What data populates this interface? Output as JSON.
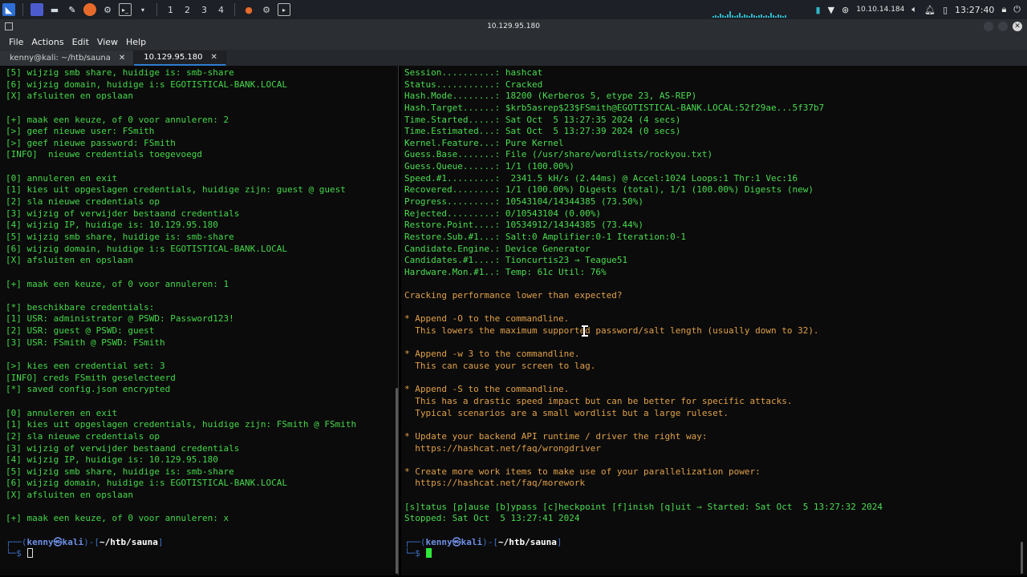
{
  "panel": {
    "workspaces": [
      "1",
      "2",
      "3",
      "4"
    ],
    "ip_label": "10.10.14.184",
    "clock": "13:27:40",
    "accent": "#2fb6c8",
    "icons": [
      "kali-menu-icon",
      "desktop-icon",
      "files-icon",
      "text-editor-icon",
      "firefox-icon",
      "settings-icon",
      "terminal-icon"
    ]
  },
  "window": {
    "title": "10.129.95.180"
  },
  "menu": [
    "File",
    "Actions",
    "Edit",
    "View",
    "Help"
  ],
  "tabs": [
    {
      "label": "kenny@kali: ~/htb/sauna",
      "active": false
    },
    {
      "label": "10.129.95.180",
      "active": true
    }
  ],
  "left_terminal": [
    "[5] wijzig smb share, huidige is: smb-share",
    "[6] wijzig domain, huidige i:s EGOTISTICAL-BANK.LOCAL",
    "[X] afsluiten en opslaan",
    "",
    "[+] maak een keuze, of 0 voor annuleren: 2",
    "[>] geef nieuwe user: FSmith",
    "[>] geef nieuwe password: FSmith",
    "[INFO]  nieuwe credentials toegevoegd",
    "",
    "[0] annuleren en exit",
    "[1] kies uit opgeslagen credentials, huidige zijn: guest @ guest",
    "[2] sla nieuwe credentials op",
    "[3] wijzig of verwijder bestaand credentials",
    "[4] wijzig IP, huidige is: 10.129.95.180",
    "[5] wijzig smb share, huidige is: smb-share",
    "[6] wijzig domain, huidige i:s EGOTISTICAL-BANK.LOCAL",
    "[X] afsluiten en opslaan",
    "",
    "[+] maak een keuze, of 0 voor annuleren: 1",
    "",
    "[*] beschikbare credentials:",
    "[1] USR: administrator @ PSWD: Password123!",
    "[2] USR: guest @ PSWD: guest",
    "[3] USR: FSmith @ PSWD: FSmith",
    "",
    "[>] kies een credential set: 3",
    "[INFO] creds FSmith geselecteerd",
    "[*] saved config.json encrypted",
    "",
    "[0] annuleren en exit",
    "[1] kies uit opgeslagen credentials, huidige zijn: FSmith @ FSmith",
    "[2] sla nieuwe credentials op",
    "[3] wijzig of verwijder bestaand credentials",
    "[4] wijzig IP, huidige is: 10.129.95.180",
    "[5] wijzig smb share, huidige is: smb-share",
    "[6] wijzig domain, huidige i:s EGOTISTICAL-BANK.LOCAL",
    "[X] afsluiten en opslaan",
    "",
    "[+] maak een keuze, of 0 voor annuleren: x",
    ""
  ],
  "right_terminal": [
    "Session..........: hashcat",
    "Status...........: Cracked",
    "Hash.Mode........: 18200 (Kerberos 5, etype 23, AS-REP)",
    "Hash.Target......: $krb5asrep$23$FSmith@EGOTISTICAL-BANK.LOCAL:52f29ae...5f37b7",
    "Time.Started.....: Sat Oct  5 13:27:35 2024 (4 secs)",
    "Time.Estimated...: Sat Oct  5 13:27:39 2024 (0 secs)",
    "Kernel.Feature...: Pure Kernel",
    "Guess.Base.......: File (/usr/share/wordlists/rockyou.txt)",
    "Guess.Queue......: 1/1 (100.00%)",
    "Speed.#1.........:  2341.5 kH/s (2.44ms) @ Accel:1024 Loops:1 Thr:1 Vec:16",
    "Recovered........: 1/1 (100.00%) Digests (total), 1/1 (100.00%) Digests (new)",
    "Progress.........: 10543104/14344385 (73.50%)",
    "Rejected.........: 0/10543104 (0.00%)",
    "Restore.Point....: 10534912/14344385 (73.44%)",
    "Restore.Sub.#1...: Salt:0 Amplifier:0-1 Iteration:0-1",
    "Candidate.Engine.: Device Generator",
    "Candidates.#1....: Tioncurtis23 → Teague51",
    "Hardware.Mon.#1..: Temp: 61c Util: 76%",
    ""
  ],
  "right_warnings": [
    "Cracking performance lower than expected?",
    "",
    "* Append -O to the commandline.",
    "  This lowers the maximum supported password/salt length (usually down to 32).",
    "",
    "* Append -w 3 to the commandline.",
    "  This can cause your screen to lag.",
    "",
    "* Append -S to the commandline.",
    "  This has a drastic speed impact but can be better for specific attacks.",
    "  Typical scenarios are a small wordlist but a large ruleset.",
    "",
    "* Update your backend API runtime / driver the right way:",
    "  https://hashcat.net/faq/wrongdriver",
    "",
    "* Create more work items to make use of your parallelization power:",
    "  https://hashcat.net/faq/morework",
    ""
  ],
  "right_tail": [
    "[s]tatus [p]ause [b]ypass [c]heckpoint [f]inish [q]uit ⇒ Started: Sat Oct  5 13:27:32 2024",
    "Stopped: Sat Oct  5 13:27:41 2024",
    ""
  ],
  "prompt": {
    "open": "┌──(",
    "user": "kenny㉿kali",
    "mid": ")-[",
    "path": "~/htb/sauna",
    "close": "]",
    "second": "└─$ "
  }
}
